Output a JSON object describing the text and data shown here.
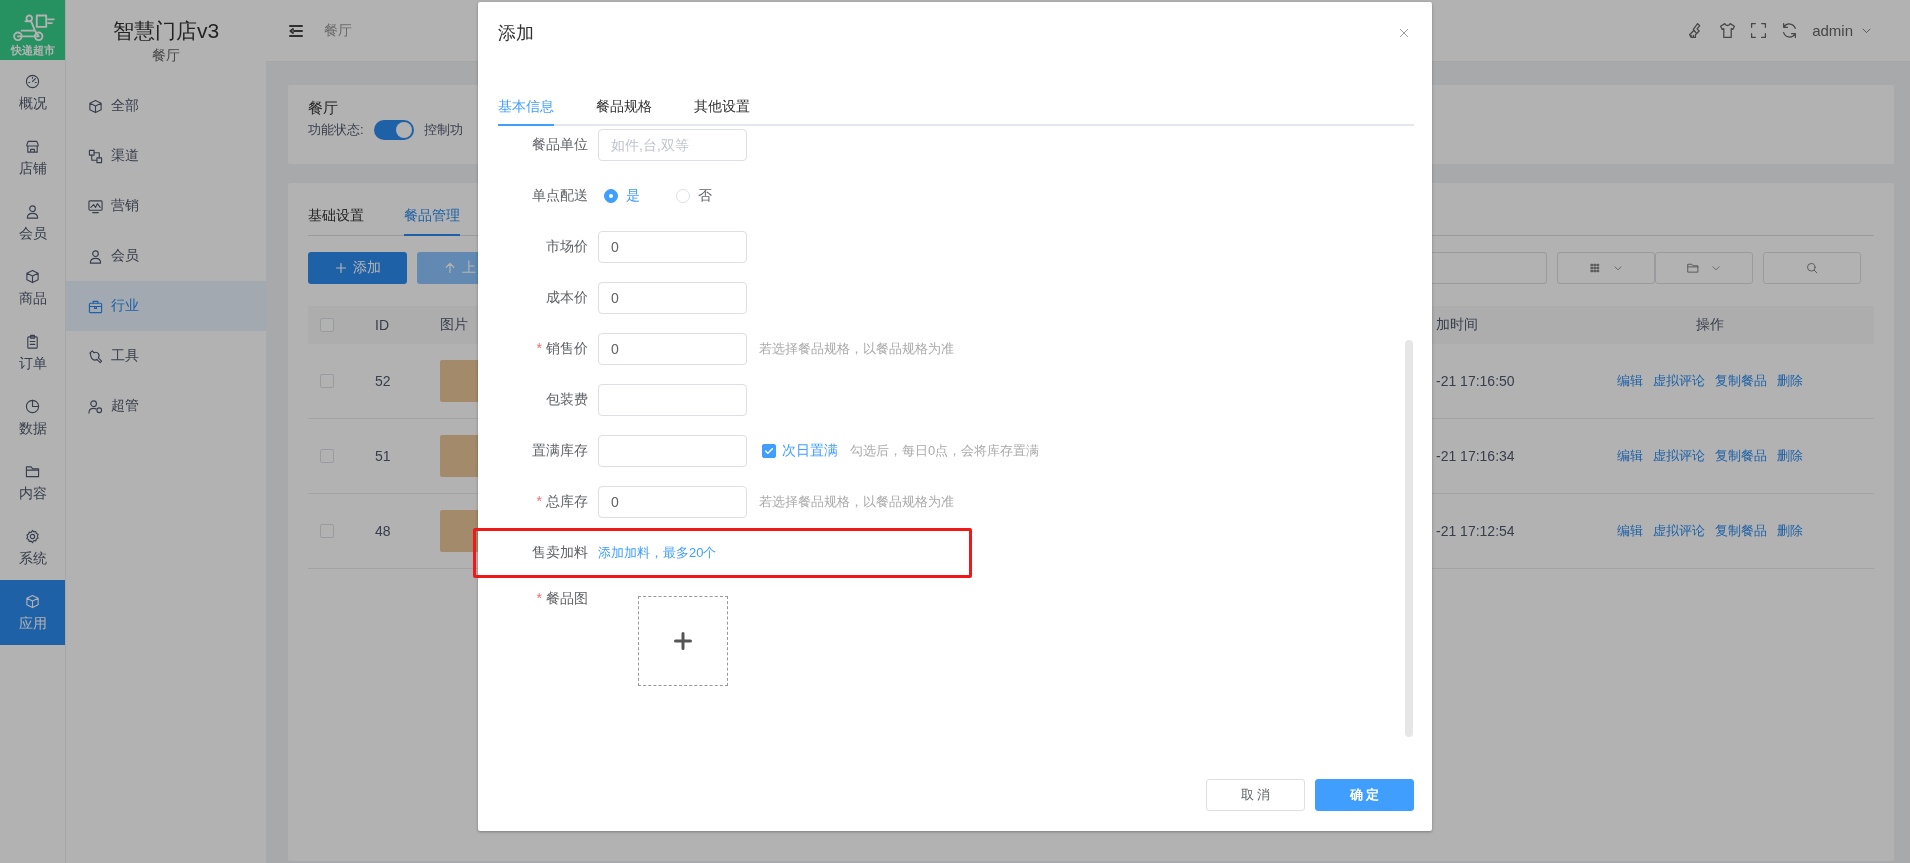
{
  "rail": {
    "logo_text": "快递超市",
    "items": [
      {
        "label": "概况",
        "selected": false
      },
      {
        "label": "店铺",
        "selected": false
      },
      {
        "label": "会员",
        "selected": false
      },
      {
        "label": "商品",
        "selected": false
      },
      {
        "label": "订单",
        "selected": false
      },
      {
        "label": "数据",
        "selected": false
      },
      {
        "label": "内容",
        "selected": false
      },
      {
        "label": "系统",
        "selected": false
      },
      {
        "label": "应用",
        "selected": true
      }
    ]
  },
  "sidebar": {
    "title": "智慧门店v3",
    "subtitle": "餐厅",
    "items": [
      {
        "label": "全部",
        "selected": false
      },
      {
        "label": "渠道",
        "selected": false
      },
      {
        "label": "营销",
        "selected": false
      },
      {
        "label": "会员",
        "selected": false
      },
      {
        "label": "行业",
        "selected": true
      },
      {
        "label": "工具",
        "selected": false
      },
      {
        "label": "超管",
        "selected": false
      }
    ]
  },
  "topbar": {
    "breadcrumb": "餐厅",
    "user": "admin"
  },
  "status_card": {
    "title": "餐厅",
    "label": "功能状态:",
    "toggle_on": true,
    "description": "控制功"
  },
  "panel": {
    "tabs": [
      {
        "label": "基础设置",
        "selected": false
      },
      {
        "label": "餐品管理",
        "selected": true
      }
    ],
    "buttons": [
      {
        "label": "添加",
        "kind": "primary"
      },
      {
        "label": "上",
        "kind": "secondary"
      }
    ],
    "table": {
      "header_checked": false,
      "columns": [
        "ID",
        "图片",
        "加时间",
        "操作"
      ],
      "rows": [
        {
          "checked": false,
          "id": "52",
          "time": "-21 17:16:50",
          "actions": [
            "编辑",
            "虚拟评论",
            "复制餐品",
            "删除"
          ]
        },
        {
          "checked": false,
          "id": "51",
          "time": "-21 17:16:34",
          "actions": [
            "编辑",
            "虚拟评论",
            "复制餐品",
            "删除"
          ]
        },
        {
          "checked": false,
          "id": "48",
          "time": "-21 17:12:54",
          "actions": [
            "编辑",
            "虚拟评论",
            "复制餐品",
            "删除"
          ]
        }
      ]
    }
  },
  "modal": {
    "title": "添加",
    "tabs": [
      {
        "label": "基本信息",
        "selected": true
      },
      {
        "label": "餐品规格",
        "selected": false
      },
      {
        "label": "其他设置",
        "selected": false
      }
    ],
    "fields": [
      {
        "kind": "text",
        "label": "餐品单位",
        "placeholder": "如件,台,双等"
      },
      {
        "kind": "radio",
        "label": "单点配送",
        "options": [
          {
            "label": "是",
            "selected": true
          },
          {
            "label": "否",
            "selected": false
          }
        ]
      },
      {
        "kind": "text",
        "label": "市场价",
        "value": "0"
      },
      {
        "kind": "text",
        "label": "成本价",
        "value": "0"
      },
      {
        "kind": "text",
        "label": "销售价",
        "mark": "*",
        "value": "0",
        "hint": "若选择餐品规格，以餐品规格为准"
      },
      {
        "kind": "text",
        "label": "包装费"
      },
      {
        "kind": "text",
        "label": "置满库存",
        "check": {
          "label": "次日置满",
          "checked": true
        },
        "hint": "勾选后，每日0点，会将库存置满"
      },
      {
        "kind": "text",
        "label": "总库存",
        "mark": "*",
        "value": "0",
        "hint": "若选择餐品规格，以餐品规格为准"
      },
      {
        "kind": "link",
        "label": "售卖加料",
        "link": "添加加料，最多20个",
        "highlighted": true
      },
      {
        "kind": "upload",
        "label": "餐品图",
        "mark": "*"
      }
    ],
    "buttons": [
      {
        "label": "取 消",
        "kind": "default"
      },
      {
        "label": "确 定",
        "kind": "primary"
      }
    ]
  }
}
